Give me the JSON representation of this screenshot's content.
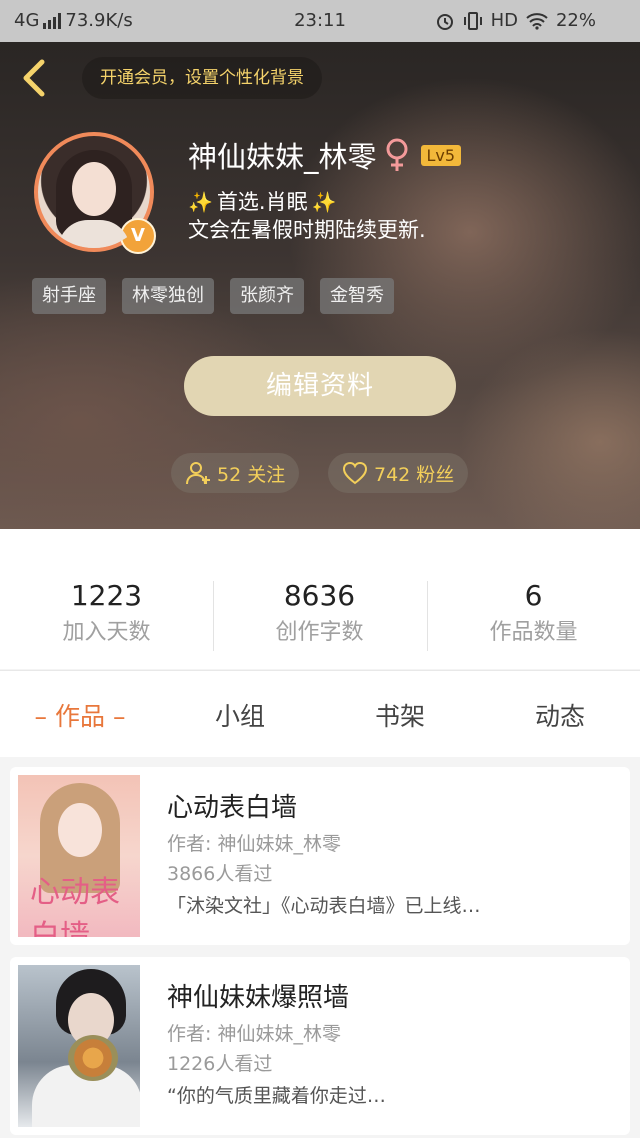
{
  "status_bar": {
    "network": "4G",
    "speed": "73.9K/s",
    "time": "23:11",
    "hd_label": "HD",
    "battery": "22%"
  },
  "header": {
    "vip_banner": "开通会员，设置个性化背景",
    "username": "神仙妹妹_林零",
    "gender_symbol": "♀",
    "level": "Lv5",
    "verified_mark": "V",
    "bio_line1": "首选.肖眠",
    "bio_line2": "文会在暑假时期陆续更新.",
    "tags": [
      "射手座",
      "林零独创",
      "张颜齐",
      "金智秀"
    ],
    "edit_button": "编辑资料",
    "following": "52 关注",
    "followers": "742 粉丝"
  },
  "stats": [
    {
      "value": "1223",
      "label": "加入天数"
    },
    {
      "value": "8636",
      "label": "创作字数"
    },
    {
      "value": "6",
      "label": "作品数量"
    }
  ],
  "tabs": [
    {
      "label": "– 作品 –",
      "active": true
    },
    {
      "label": "小组",
      "active": false
    },
    {
      "label": "书架",
      "active": false
    },
    {
      "label": "动态",
      "active": false
    }
  ],
  "works": [
    {
      "title": "心动表白墙",
      "author": "作者: 神仙妹妹_林零",
      "views": "3866人看过",
      "description": "「沐染文社」《心动表白墙》已上线…",
      "cover_text": "心动表白墙"
    },
    {
      "title": "神仙妹妹爆照墙",
      "author": "作者: 神仙妹妹_林零",
      "views": "1226人看过",
      "description": "“你的气质里藏着你走过…"
    }
  ],
  "colors": {
    "accent": "#e8773b",
    "gold": "#f3cf5a",
    "edit_button": "#e2d6b3"
  }
}
